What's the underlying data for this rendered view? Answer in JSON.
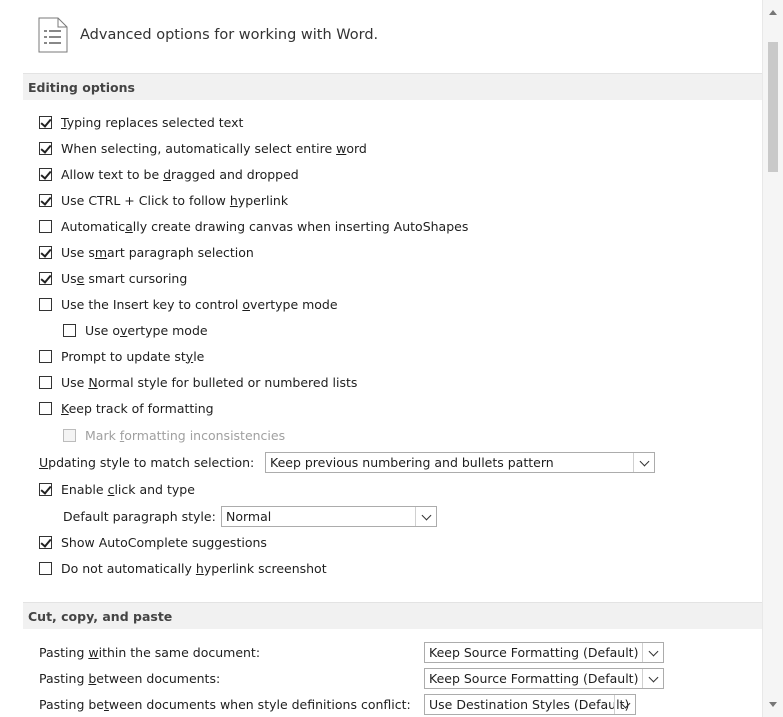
{
  "header": {
    "title": "Advanced options for working with Word.",
    "icon": "document-list-icon"
  },
  "sections": {
    "editing": "Editing options",
    "cutcopy": "Cut, copy, and paste"
  },
  "editing_options": [
    {
      "pre": "",
      "u": "T",
      "post": "yping replaces selected text",
      "checked": true
    },
    {
      "pre": "When selecting, automatically select entire ",
      "u": "w",
      "post": "ord",
      "checked": true
    },
    {
      "pre": "Allow text to be ",
      "u": "d",
      "post": "ragged and dropped",
      "checked": true
    },
    {
      "pre": "Use CTRL + Click to follow ",
      "u": "h",
      "post": "yperlink",
      "checked": true
    },
    {
      "pre": "Automatic",
      "u": "a",
      "post": "lly create drawing canvas when inserting AutoShapes",
      "checked": false
    },
    {
      "pre": "Use s",
      "u": "m",
      "post": "art paragraph selection",
      "checked": true
    },
    {
      "pre": "Us",
      "u": "e",
      "post": " smart cursoring",
      "checked": true
    },
    {
      "pre": "Use the Insert key to control ",
      "u": "o",
      "post": "vertype mode",
      "checked": false
    },
    {
      "pre": "Use o",
      "u": "v",
      "post": "ertype mode",
      "checked": false
    },
    {
      "pre": "Prompt to update st",
      "u": "y",
      "post": "le",
      "checked": false
    },
    {
      "pre": "Use ",
      "u": "N",
      "post": "ormal style for bulleted or numbered lists",
      "checked": false
    },
    {
      "pre": "",
      "u": "K",
      "post": "eep track of formatting",
      "checked": false
    },
    {
      "pre": "Mark ",
      "u": "f",
      "post": "ormatting inconsistencies",
      "checked": false,
      "disabled": true
    }
  ],
  "updating_style": {
    "label_u": "U",
    "label_rest": "pdating style to match selection:",
    "value": "Keep previous numbering and bullets pattern"
  },
  "click_type": {
    "pre": "Enable ",
    "u": "c",
    "post": "lick and type",
    "checked": true
  },
  "default_paragraph": {
    "label": "Default paragraph style:",
    "value": "Normal"
  },
  "autocomplete": {
    "label": "Show AutoComplete suggestions",
    "checked": true
  },
  "no_hyperlink": {
    "pre": "Do not automatically ",
    "u": "h",
    "post": "yperlink screenshot",
    "checked": false
  },
  "paste_options": [
    {
      "pre": "Pasting ",
      "u": "w",
      "post": "ithin the same document:",
      "value": "Keep Source Formatting (Default)"
    },
    {
      "pre": "Pasting ",
      "u": "b",
      "post": "etween documents:",
      "value": "Keep Source Formatting (Default)"
    },
    {
      "pre": "Pasting be",
      "u": "t",
      "post": "ween documents when style definitions conflict:",
      "value": "Use Destination Styles (Default)"
    }
  ]
}
